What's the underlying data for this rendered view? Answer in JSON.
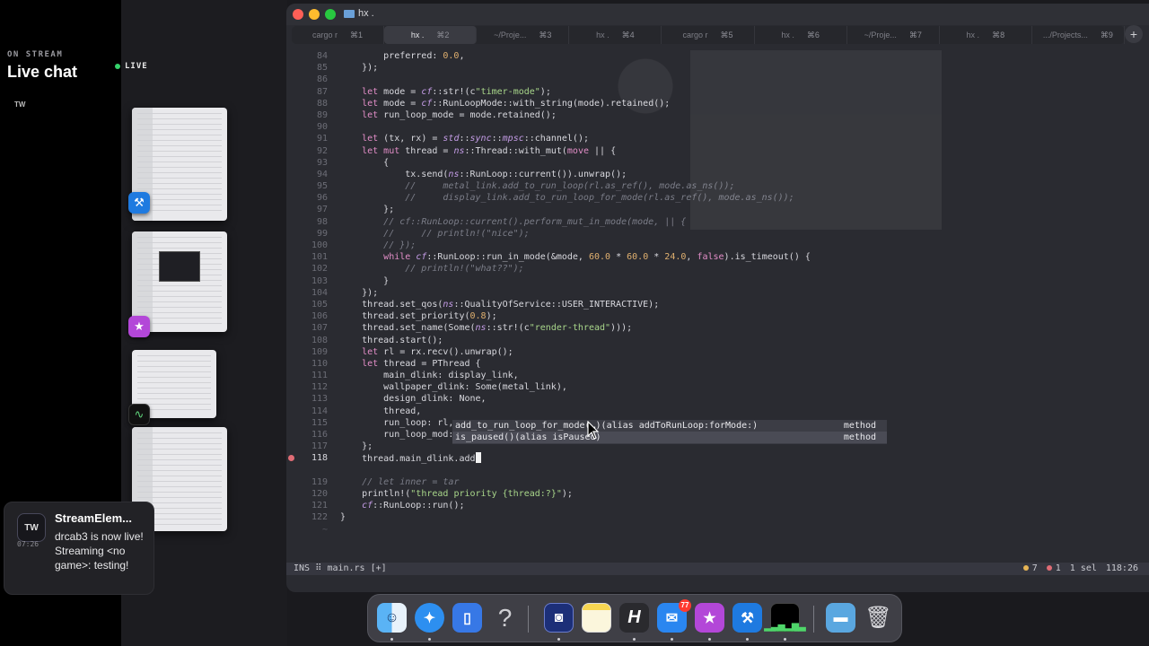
{
  "stream": {
    "on_stream": "ON STREAM",
    "title": "Live chat",
    "tw_label": "TW",
    "live": "LIVE"
  },
  "notification": {
    "icon_label": "TW",
    "time": "07:26",
    "title": "StreamElem...",
    "body": "drcab3 is now live! Streaming <no game>: testing!"
  },
  "window": {
    "title": "hx .",
    "tabs": [
      {
        "label": "cargo r",
        "shortcut": "⌘1"
      },
      {
        "label": "hx .",
        "shortcut": "⌘2",
        "active": true
      },
      {
        "label": "~/Proje...",
        "shortcut": "⌘3"
      },
      {
        "label": "hx .",
        "shortcut": "⌘4"
      },
      {
        "label": "cargo r",
        "shortcut": "⌘5"
      },
      {
        "label": "hx .",
        "shortcut": "⌘6"
      },
      {
        "label": "~/Proje...",
        "shortcut": "⌘7"
      },
      {
        "label": "hx .",
        "shortcut": "⌘8"
      },
      {
        "label": ".../Projects...",
        "shortcut": "⌘9"
      }
    ],
    "new_tab": "+"
  },
  "editor": {
    "lines": [
      {
        "n": "84",
        "indent": "        ",
        "html": "preferred: <span class='num'>0.0</span>,"
      },
      {
        "n": "85",
        "indent": "    ",
        "html": "});"
      },
      {
        "n": "86",
        "indent": "",
        "html": ""
      },
      {
        "n": "87",
        "indent": "    ",
        "html": "<span class='kw'>let</span> mode = <span class='ns'>cf</span>::str!(c<span class='str'>\"timer-mode\"</span>);"
      },
      {
        "n": "88",
        "indent": "    ",
        "html": "<span class='kw'>let</span> mode = <span class='ns'>cf</span>::RunLoopMode::with_string(mode).retained();"
      },
      {
        "n": "89",
        "indent": "    ",
        "html": "<span class='kw'>let</span> run_loop_mode = mode.retained();"
      },
      {
        "n": "90",
        "indent": "",
        "html": ""
      },
      {
        "n": "91",
        "indent": "    ",
        "html": "<span class='kw'>let</span> (tx, rx) = <span class='ns'>std</span>::<span class='ns'>sync</span>::<span class='ns'>mpsc</span>::channel();"
      },
      {
        "n": "92",
        "indent": "    ",
        "html": "<span class='kw'>let mut</span> thread = <span class='ns'>ns</span>::Thread::with_mut(<span class='kw'>move</span> || {"
      },
      {
        "n": "93",
        "indent": "        ",
        "html": "{"
      },
      {
        "n": "94",
        "indent": "            ",
        "html": "tx.send(<span class='ns'>ns</span>::RunLoop::current()).unwrap();"
      },
      {
        "n": "95",
        "indent": "            ",
        "html": "<span class='cm'>//     metal_link.add_to_run_loop(rl.as_ref(), mode.as_ns());</span>"
      },
      {
        "n": "96",
        "indent": "            ",
        "html": "<span class='cm'>//     display_link.add_to_run_loop_for_mode(rl.as_ref(), mode.as_ns());</span>"
      },
      {
        "n": "97",
        "indent": "        ",
        "html": "};"
      },
      {
        "n": "98",
        "indent": "        ",
        "html": "<span class='cm'>// cf::RunLoop::current().perform_mut_in_mode(mode, || {</span>"
      },
      {
        "n": "99",
        "indent": "        ",
        "html": "<span class='cm'>//     // println!(\"nice\");</span>"
      },
      {
        "n": "100",
        "indent": "        ",
        "html": "<span class='cm'>// });</span>"
      },
      {
        "n": "101",
        "indent": "        ",
        "html": "<span class='kw'>while</span> <span class='ns'>cf</span>::RunLoop::run_in_mode(&amp;mode, <span class='num'>60.0</span> * <span class='num'>60.0</span> * <span class='num'>24.0</span>, <span class='kw'>false</span>).is_timeout() {"
      },
      {
        "n": "102",
        "indent": "            ",
        "html": "<span class='cm'>// println!(\"what??\");</span>"
      },
      {
        "n": "103",
        "indent": "        ",
        "html": "}"
      },
      {
        "n": "104",
        "indent": "    ",
        "html": "});"
      },
      {
        "n": "105",
        "indent": "    ",
        "html": "thread.set_qos(<span class='ns'>ns</span>::QualityOfService::USER_INTERACTIVE);"
      },
      {
        "n": "106",
        "indent": "    ",
        "html": "thread.set_priority(<span class='num'>0.8</span>);"
      },
      {
        "n": "107",
        "indent": "    ",
        "html": "thread.set_name(Some(<span class='ns'>ns</span>::str!(c<span class='str'>\"render-thread\"</span>)));"
      },
      {
        "n": "108",
        "indent": "    ",
        "html": "thread.start();"
      },
      {
        "n": "109",
        "indent": "    ",
        "html": "<span class='kw'>let</span> rl = rx.recv().unwrap();"
      },
      {
        "n": "110",
        "indent": "    ",
        "html": "<span class='kw'>let</span> thread = PThread {"
      },
      {
        "n": "111",
        "indent": "        ",
        "html": "main_dlink: display_link,"
      },
      {
        "n": "112",
        "indent": "        ",
        "html": "wallpaper_dlink: Some(metal_link),"
      },
      {
        "n": "113",
        "indent": "        ",
        "html": "design_dlink: None,"
      },
      {
        "n": "114",
        "indent": "        ",
        "html": "thread,"
      },
      {
        "n": "115",
        "indent": "        ",
        "html": "run_loop: rl,"
      },
      {
        "n": "116",
        "indent": "        ",
        "html": "run_loop_mod: run_loop_mode,"
      },
      {
        "n": "117",
        "indent": "    ",
        "html": "};"
      },
      {
        "n": "118",
        "indent": "    ",
        "html": "thread.main_dlink.add<span class='cursor-block'></span>",
        "breakpoint": true,
        "current": true
      },
      {
        "n": "",
        "indent": "",
        "html": ""
      },
      {
        "n": "119",
        "indent": "    ",
        "html": "<span class='cm'>// let inner = tar</span>"
      },
      {
        "n": "120",
        "indent": "    ",
        "html": "println!(<span class='str'>\"thread priority {thread:?}\"</span>);"
      },
      {
        "n": "121",
        "indent": "    ",
        "html": "<span class='ns'>cf</span>::RunLoop::run();"
      },
      {
        "n": "122",
        "indent": "",
        "html": "}"
      },
      {
        "n": "~",
        "indent": "",
        "html": "",
        "tilde": true
      }
    ],
    "completions": [
      {
        "label": "add_to_run_loop_for_mode(…)(alias addToRunLoop:forMode:)",
        "kind": "method"
      },
      {
        "label": "is_paused()(alias isPaused)",
        "kind": "method"
      }
    ]
  },
  "statusbar": {
    "mode": "INS",
    "file": "main.rs",
    "modified": "[+]",
    "warnings": "7",
    "errors": "1",
    "selection": "1 sel",
    "position": "118:26"
  },
  "dock": {
    "mail_badge": "77",
    "apps": [
      "finder-icon",
      "safari-icon",
      "simulator-icon",
      "help-icon",
      "app-store-connect-icon",
      "notes-icon",
      "helix-icon",
      "mail-icon",
      "feedback-icon",
      "xcode-beta-icon",
      "activity-monitor-icon",
      "folder-icon",
      "trash-icon"
    ]
  }
}
